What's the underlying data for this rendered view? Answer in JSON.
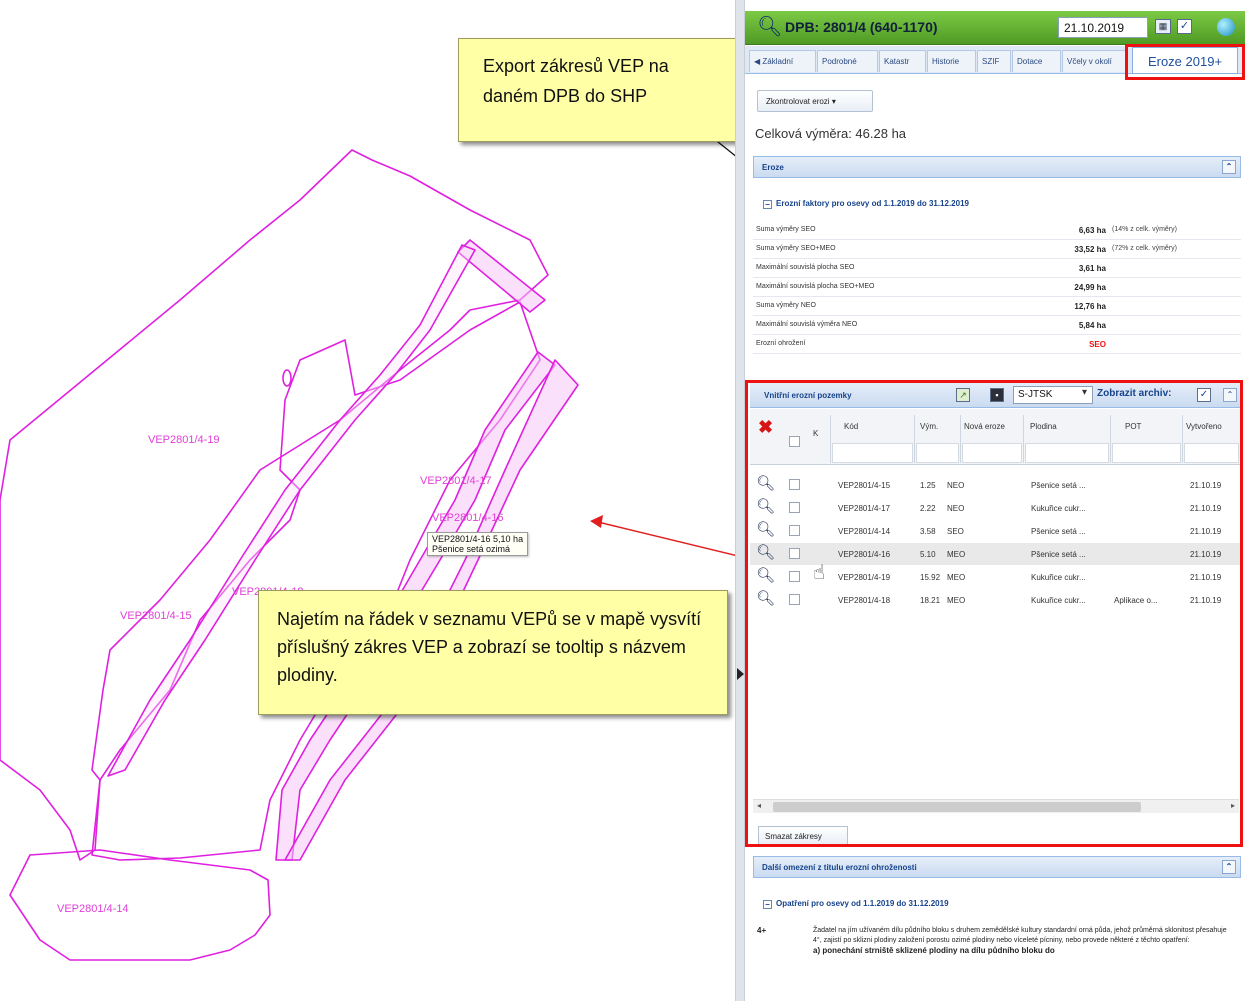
{
  "map": {
    "vep_labels": [
      "VEP2801/4-19",
      "VEP2801/4-17",
      "VEP2801/4-16",
      "VEP2801/4-18",
      "VEP2801/4-15",
      "VEP2801/4-14"
    ],
    "tooltip": {
      "line1": "VEP2801/4-16 5,10 ha",
      "line2": "Pšenice setá ozimá"
    },
    "polygon_color": "#e020e0",
    "arrow_color": "#e02020"
  },
  "callouts": {
    "export_text": "Export zákresů VEP na daném DPB do SHP",
    "hover_text": "Najetím na řádek v seznamu VEPů se v mapě vysvítí příslušný zákres VEP a zobrazí se tooltip s názvem plodiny."
  },
  "header": {
    "title": "DPB: 2801/4 (640-1170)",
    "date": "21.10.2019",
    "accent": "#5aa82e"
  },
  "tabs": [
    "Základní",
    "Podrobné",
    "Katastr",
    "Historie",
    "SZIF",
    "Dotace",
    "Včely v okolí"
  ],
  "active_tab": "Eroze 2019+",
  "check_button": "Zkontrolovat erozi",
  "total_area": "Celková výměra: 46.28 ha",
  "eroze": {
    "title": "Eroze",
    "factors_title": "Erozní faktory pro osevy od 1.1.2019 do 31.12.2019",
    "rows": [
      {
        "label": "Suma výměry SEO",
        "value": "6,63 ha",
        "note": "(14% z celk. výměry)"
      },
      {
        "label": "Suma výměry SEO+MEO",
        "value": "33,52 ha",
        "note": "(72% z celk. výměry)"
      },
      {
        "label": "Maximální souvislá plocha SEO",
        "value": "3,61 ha",
        "note": ""
      },
      {
        "label": "Maximální souvislá plocha SEO+MEO",
        "value": "24,99 ha",
        "note": ""
      },
      {
        "label": "Suma výměry NEO",
        "value": "12,76 ha",
        "note": ""
      },
      {
        "label": "Maximální souvislá výměra NEO",
        "value": "5,84 ha",
        "note": ""
      },
      {
        "label": "Erozní ohrožení",
        "value": "SEO",
        "note": ""
      }
    ]
  },
  "veps": {
    "title": "Vnitřní erozní pozemky",
    "coord_system": "S-JTSK",
    "archive_label": "Zobrazit archiv:",
    "columns": [
      "K",
      "Kód",
      "Vým.",
      "Nová eroze",
      "Plodina",
      "POT",
      "Vytvořeno"
    ],
    "rows": [
      {
        "kod": "VEP2801/4-15",
        "vym": "1.25",
        "eroze": "NEO",
        "plodina": "Pšenice setá ...",
        "pot": "",
        "vytvoreno": "21.10.19"
      },
      {
        "kod": "VEP2801/4-17",
        "vym": "2.22",
        "eroze": "NEO",
        "plodina": "Kukuřice cukr...",
        "pot": "",
        "vytvoreno": "21.10.19"
      },
      {
        "kod": "VEP2801/4-14",
        "vym": "3.58",
        "eroze": "SEO",
        "plodina": "Pšenice setá ...",
        "pot": "",
        "vytvoreno": "21.10.19"
      },
      {
        "kod": "VEP2801/4-16",
        "vym": "5.10",
        "eroze": "MEO",
        "plodina": "Pšenice setá ...",
        "pot": "",
        "vytvoreno": "21.10.19"
      },
      {
        "kod": "VEP2801/4-19",
        "vym": "15.92",
        "eroze": "MEO",
        "plodina": "Kukuřice cukr...",
        "pot": "",
        "vytvoreno": "21.10.19"
      },
      {
        "kod": "VEP2801/4-18",
        "vym": "18.21",
        "eroze": "MEO",
        "plodina": "Kukuřice cukr...",
        "pot": "Aplikace o...",
        "vytvoreno": "21.10.19"
      }
    ],
    "clear_button": "Smazat zákresy"
  },
  "limits": {
    "title": "Další omezení z titulu erozní ohroženosti",
    "measures_title": "Opatření pro osevy od 1.1.2019 do 31.12.2019",
    "code": "4+",
    "text": "Žadatel na jím užívaném dílu půdního bloku s druhem zemědělské kultury standardní orná půda, jehož průměrná sklonitost přesahuje 4°, zajistí po sklizni plodiny založení porostu ozimé plodiny nebo víceleté pícniny, nebo provede některé z těchto opatření:",
    "text_bold": "a) ponechání strniště sklizené plodiny na dílu půdního bloku do"
  },
  "frame_color": "#ee1111"
}
